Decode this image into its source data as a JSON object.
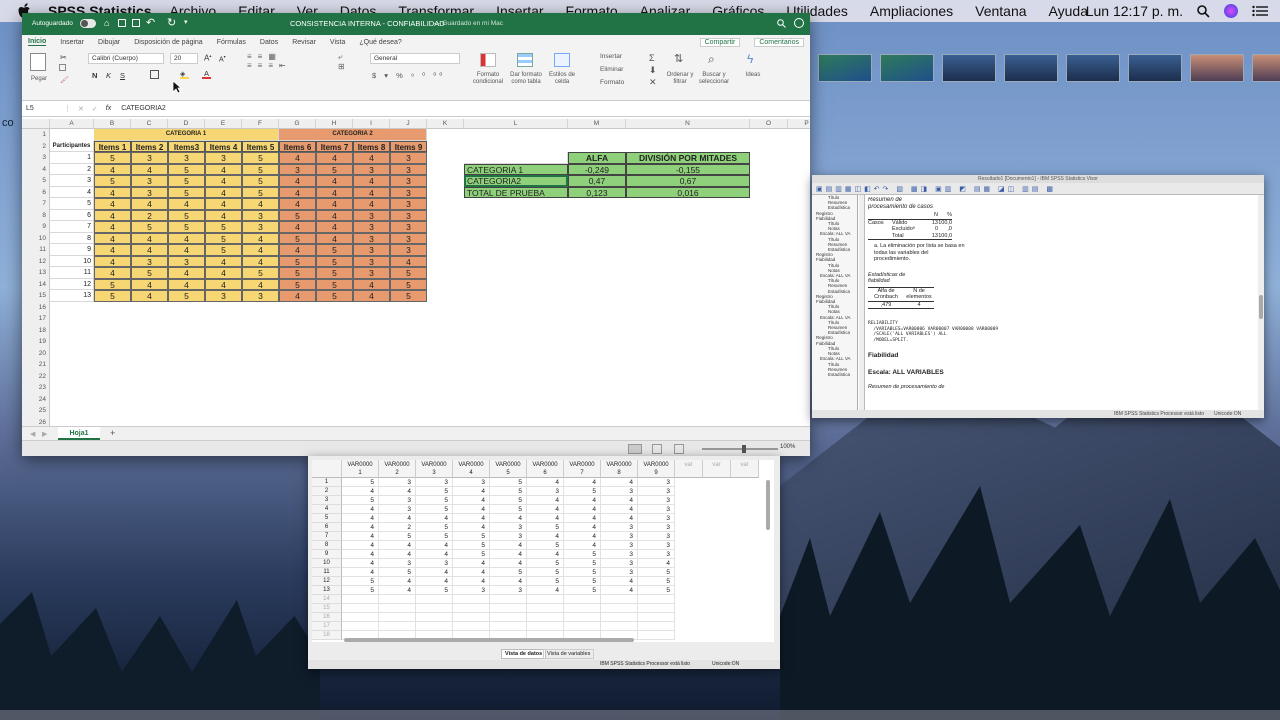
{
  "menubar": {
    "app": "SPSS Statistics",
    "items": [
      "Archivo",
      "Editar",
      "Ver",
      "Datos",
      "Transformar",
      "Insertar",
      "Formato",
      "Analizar",
      "Gráficos",
      "Utilidades",
      "Ampliaciones",
      "Ventana",
      "Ayuda"
    ],
    "clock": "Lun 12:17 p. m."
  },
  "desktop": {
    "partial_text": "co"
  },
  "excel": {
    "autosave_label": "Autoguardado",
    "title": "CONSISTENCIA INTERNA - CONFIABILIDAD",
    "saved_status": "— Guardado en mi Mac",
    "tabs": [
      "Inicio",
      "Insertar",
      "Dibujar",
      "Disposición de página",
      "Fórmulas",
      "Datos",
      "Revisar",
      "Vista"
    ],
    "tell_me": "¿Qué desea?",
    "share": "Compartir",
    "comments": "Comentarios",
    "ribbon": {
      "paste": "Pegar",
      "font": "Calibri (Cuerpo)",
      "size": "20",
      "number_format": "General",
      "cond_format": "Formato condicional",
      "table_format": "Dar formato como tabla",
      "cell_styles": "Estilos de celda",
      "insert": "Insertar",
      "delete": "Eliminar",
      "format": "Formato",
      "sort": "Ordenar y filtrar",
      "find": "Buscar y seleccionar",
      "ideas": "Ideas"
    },
    "name_box": "L5",
    "formula": "CATEGORIA2",
    "sheet": "Hoja1",
    "zoom": "100%",
    "columns": [
      "A",
      "B",
      "C",
      "D",
      "E",
      "F",
      "G",
      "H",
      "I",
      "J",
      "K",
      "L",
      "M",
      "N",
      "O",
      "P"
    ],
    "category_labels": [
      "CATEGORIA 1",
      "CATEGORIA 2"
    ],
    "header_participants": "Participantes",
    "item_headers": [
      "Items 1",
      "Items 2",
      "Items3",
      "Items 4",
      "Items 5",
      "Items 6",
      "Items 7",
      "Items 8",
      "Items 9"
    ],
    "rows": [
      [
        1,
        5,
        3,
        3,
        3,
        5,
        4,
        4,
        4,
        3
      ],
      [
        2,
        4,
        4,
        5,
        4,
        5,
        3,
        5,
        3,
        3
      ],
      [
        3,
        5,
        3,
        5,
        4,
        5,
        4,
        4,
        4,
        3
      ],
      [
        4,
        4,
        3,
        5,
        4,
        5,
        4,
        4,
        4,
        3
      ],
      [
        5,
        4,
        4,
        4,
        4,
        4,
        4,
        4,
        4,
        3
      ],
      [
        6,
        4,
        2,
        5,
        4,
        3,
        5,
        4,
        3,
        3
      ],
      [
        7,
        4,
        5,
        5,
        5,
        3,
        4,
        4,
        3,
        3
      ],
      [
        8,
        4,
        4,
        4,
        5,
        4,
        5,
        4,
        3,
        3
      ],
      [
        9,
        4,
        4,
        4,
        5,
        4,
        4,
        5,
        3,
        3
      ],
      [
        10,
        4,
        3,
        3,
        4,
        4,
        5,
        5,
        3,
        4
      ],
      [
        11,
        4,
        5,
        4,
        4,
        5,
        5,
        5,
        3,
        5
      ],
      [
        12,
        5,
        4,
        4,
        4,
        4,
        5,
        5,
        4,
        5
      ],
      [
        13,
        5,
        4,
        5,
        3,
        3,
        4,
        5,
        4,
        5
      ]
    ],
    "results": {
      "headers": [
        "ALFA",
        "DIVISIÓN POR MITADES"
      ],
      "rows": [
        [
          "CATEGORIA 1",
          "-0,249",
          "-0,155"
        ],
        [
          "CATEGORIA2",
          "0,47",
          "0,67"
        ],
        [
          "TOTAL DE PRUEBA",
          "0,123",
          "0,016"
        ]
      ]
    },
    "colors": {
      "cat1": "#f7d774",
      "cat2": "#e79a6d",
      "results": "#8fd17a",
      "title_bar": "#217346"
    }
  },
  "viewer": {
    "title": "Resultado1 [Documento1] - IBM SPSS Statistics Visor",
    "tree": [
      "Título",
      "Resumen",
      "Estadística",
      "Registro",
      "Fiabilidad",
      "Título",
      "Notas",
      "Escala: ALL VA",
      "Título",
      "Resumen",
      "Estadística",
      "Registro",
      "Fiabilidad",
      "Título",
      "Notas",
      "Escala: ALL VA",
      "Título",
      "Resumen",
      "Estadística",
      "Registro",
      "Fiabilidad",
      "Título",
      "Notas",
      "Escala: ALL VA",
      "Título",
      "Resumen",
      "Estadística",
      "Registro",
      "Fiabilidad",
      "Título",
      "Notas",
      "Escala: ALL VA",
      "Título",
      "Resumen",
      "Estadística"
    ],
    "summary_title": "Resumen de procesamiento de casos",
    "summary": {
      "hdr": [
        "N",
        "%"
      ],
      "rows": [
        [
          "Casos",
          "Válido",
          "13",
          "100,0"
        ],
        [
          "",
          "Excluidoᵃ",
          "0",
          ",0"
        ],
        [
          "",
          "Total",
          "13",
          "100,0"
        ]
      ]
    },
    "footnote": "a. La eliminación por lista se basa en todas las variables del procedimiento.",
    "stats_title": "Estadísticas de fiabilidad",
    "stats": {
      "hdr": [
        "Alfa de Cronbach",
        "N de elementos"
      ],
      "vals": [
        ",479",
        "4"
      ]
    },
    "syntax": "RELIABILITY\n  /VARIABLES=VAR00006 VAR00007 VAR00008 VAR00009\n  /SCALE('ALL VARIABLES') ALL\n  /MODEL=SPLIT.",
    "section1": "Fiabilidad",
    "section2": "Escala: ALL VARIABLES",
    "section3": "Resumen de procesamiento de",
    "status": "IBM SPSS Statistics Processor está listo",
    "unicode": "Unicode:ON"
  },
  "data_editor": {
    "var_names": [
      "VAR0000\n1",
      "VAR0000\n2",
      "VAR0000\n3",
      "VAR0000\n4",
      "VAR0000\n5",
      "VAR0000\n6",
      "VAR0000\n7",
      "VAR0000\n8",
      "VAR0000\n9",
      "var",
      "var",
      "var"
    ],
    "tab_data": "Vista de datos",
    "tab_vars": "Vista de variables",
    "status": "IBM SPSS Statistics Processor está listo",
    "unicode": "Unicode:ON"
  }
}
